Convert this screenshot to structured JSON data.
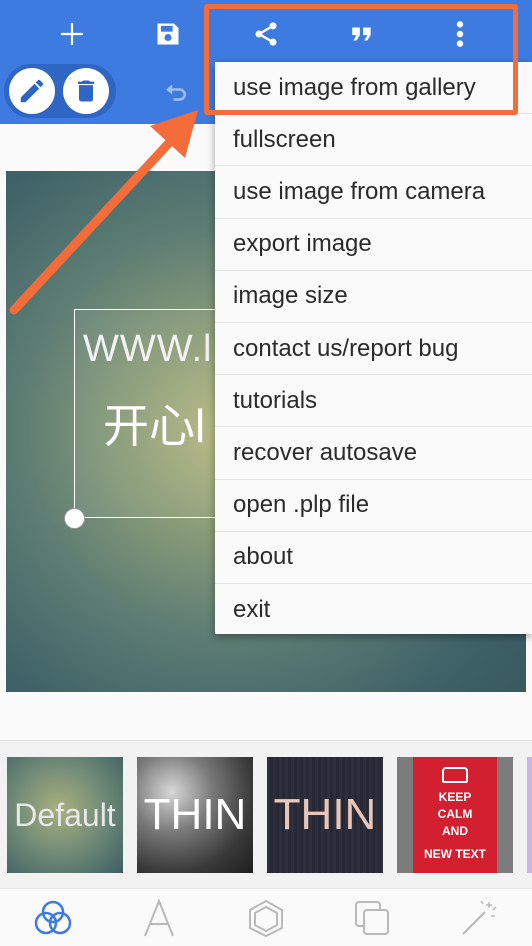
{
  "toolbar": {
    "color": "#3e7be0",
    "icons": [
      "add-icon",
      "save-icon",
      "share-icon",
      "quote-icon",
      "more-vert-icon",
      "edit-icon",
      "delete-icon",
      "undo-icon"
    ]
  },
  "canvas": {
    "text_line1": "WWW.l",
    "text_line2": "开心l"
  },
  "menu": {
    "items": [
      "use image from gallery",
      "fullscreen",
      "use image from camera",
      "export image",
      "image size",
      "contact us/report bug",
      "tutorials",
      "recover autosave",
      "open .plp file",
      "about",
      "exit"
    ]
  },
  "annotation": {
    "color": "#f36c3a"
  },
  "styles": {
    "thumbs": [
      "Default",
      "THIN",
      "THIN"
    ],
    "poster_lines": [
      "KEEP",
      "CALM",
      "AND",
      "NEW TEXT"
    ]
  },
  "bottom_nav": {
    "icons": [
      "backgrounds-icon",
      "text-font-icon",
      "shape-icon",
      "layers-icon",
      "magic-wand-icon"
    ]
  }
}
